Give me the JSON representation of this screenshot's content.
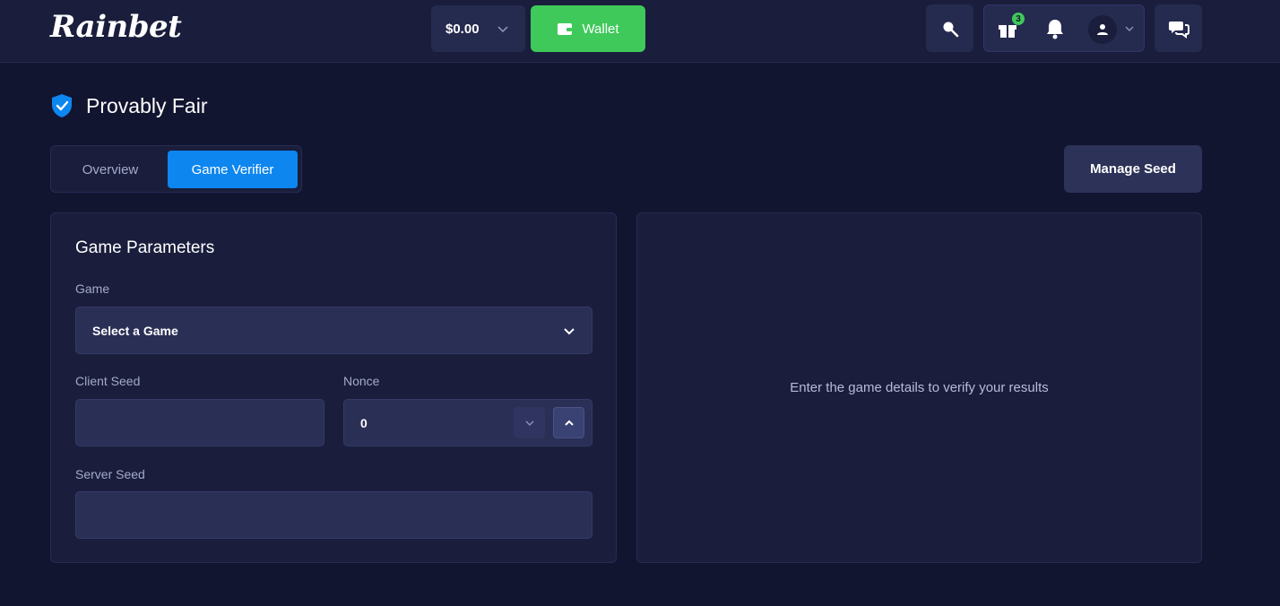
{
  "header": {
    "logo_text": "Rainbet",
    "balance": "$0.00",
    "wallet_label": "Wallet",
    "rewards_badge": "3",
    "icons": [
      "search-icon",
      "gift-icon",
      "bell-icon",
      "user-icon",
      "chat-icon",
      "chevron-down-icon",
      "wallet-icon"
    ]
  },
  "page": {
    "title": "Provably Fair",
    "title_icon": "shield-check-icon"
  },
  "tabs": [
    {
      "label": "Overview",
      "active": false
    },
    {
      "label": "Game Verifier",
      "active": true
    }
  ],
  "manage_seed_label": "Manage Seed",
  "params": {
    "title": "Game Parameters",
    "game_label": "Game",
    "game_value": "Select a Game",
    "client_seed_label": "Client Seed",
    "client_seed_value": "",
    "nonce_label": "Nonce",
    "nonce_value": "0",
    "server_seed_label": "Server Seed",
    "server_seed_value": ""
  },
  "results": {
    "hint": "Enter the game details to verify your results"
  },
  "colors": {
    "background": "#121530",
    "panel": "#1a1e3c",
    "accent_blue": "#0e86ef",
    "wallet_green": "#3ec95a"
  }
}
